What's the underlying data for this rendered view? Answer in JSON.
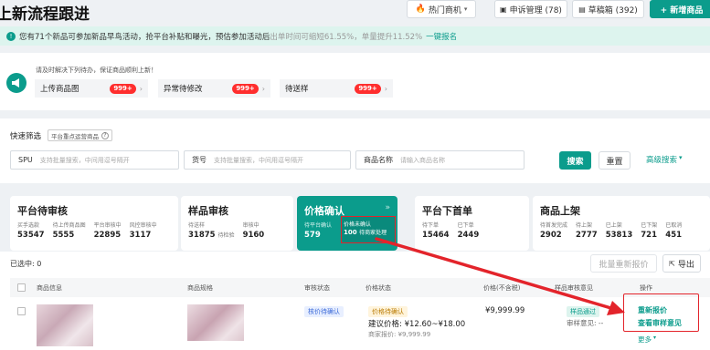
{
  "header": {
    "title": "上新流程跟进",
    "hot_label": "热门商机",
    "complaint_label": "申诉管理 (78)",
    "draft_label": "草稿箱 (392)",
    "new_label": "+ 新增商品"
  },
  "notice": {
    "text_a": "您有71个新品可参加新品早鸟活动，抢平台补贴和曝光，预估参加活动后",
    "text_b": "出单时间可缩短61.55%，单量提升11.52%",
    "link": "一键报名"
  },
  "todo": {
    "prompt": "请及时解决下列待办，保证商品顺利上新！",
    "items": [
      {
        "label": "上传商品图",
        "count": "999+"
      },
      {
        "label": "异常待修改",
        "count": "999+"
      },
      {
        "label": "待送样",
        "count": "999+"
      }
    ]
  },
  "filter": {
    "title": "快速筛选",
    "chip": "平台重点运营商品",
    "spu_label": "SPU",
    "spu_placeholder": "支持批量搜索，中间用逗号隔开",
    "sku_label": "货号",
    "sku_placeholder": "支持批量搜索，中间用逗号隔开",
    "name_label": "商品名称",
    "name_placeholder": "请输入商品名称",
    "search": "搜索",
    "reset": "重置",
    "advanced": "高级搜索"
  },
  "stages": [
    {
      "title": "平台待审核",
      "stats": [
        {
          "k": "买手选款",
          "v": "53547"
        },
        {
          "k": "待上传商品图",
          "v": "5555"
        },
        {
          "k": "平台审核中",
          "v": "22895"
        },
        {
          "k": "风控审核中",
          "v": "3117"
        }
      ]
    },
    {
      "title": "样品审核",
      "stats": [
        {
          "k": "待送样",
          "v": "31875"
        },
        {
          "k": "审核中",
          "v": "9160"
        }
      ],
      "extra": "待检验"
    },
    {
      "title": "价格确认",
      "stats": [
        {
          "k": "待平台确认",
          "v": "579"
        },
        {
          "k": "价格未确认",
          "v": "100"
        }
      ],
      "extra": "待商家处理"
    },
    {
      "title": "平台下首单",
      "stats": [
        {
          "k": "待下单",
          "v": "15464"
        },
        {
          "k": "已下单",
          "v": "2449"
        }
      ]
    },
    {
      "title": "商品上架",
      "stats": [
        {
          "k": "待首发完成",
          "v": "2902"
        },
        {
          "k": "待上架",
          "v": "2777"
        },
        {
          "k": "已上架",
          "v": "53813"
        },
        {
          "k": "已下架",
          "v": "721"
        },
        {
          "k": "已取消",
          "v": "451"
        }
      ]
    }
  ],
  "selected": "已选中: 0",
  "batch_label": "批量重新报价",
  "export_label": "导出",
  "table": {
    "headers": [
      "商品信息",
      "商品规格",
      "审核状态",
      "价格状态",
      "价格(不含税)",
      "样品审核意见",
      "操作"
    ],
    "row": {
      "audit": "核价待确认",
      "price_status": "价格待确认",
      "suggest_label": "建议价格:",
      "suggest": "¥12.60~¥18.00",
      "merchant_label": "商家报价:",
      "merchant": "¥9,999.99",
      "price": "¥9,999.99",
      "sample_tag": "样品通过",
      "sample_label": "审样意见:",
      "sample_val": "--",
      "ops": [
        "重新报价",
        "查看审样意见",
        "更多"
      ]
    }
  },
  "colors": {
    "teal": "#0b9c8c",
    "red": "#e3242b"
  }
}
